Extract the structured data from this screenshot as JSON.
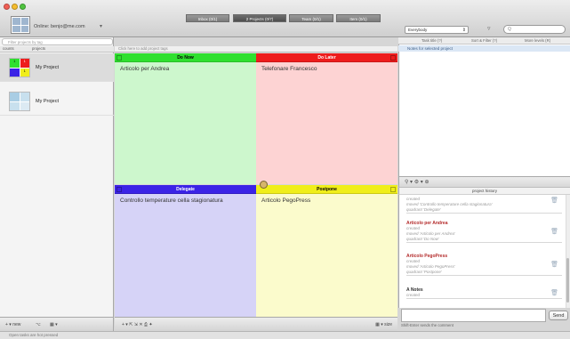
{
  "window": {
    "online_label": "Online: benjo@me.com",
    "tabs": [
      {
        "label": "Inbox (0/1)",
        "active": false
      },
      {
        "label": "2 Projects (0/7)",
        "active": true
      },
      {
        "label": "Team (0/1)",
        "active": false
      },
      {
        "label": "Item (0/1)",
        "active": false
      }
    ],
    "filter_select": "Everybody",
    "search_placeholder": "Q"
  },
  "sidebar": {
    "filter_placeholder": "Filter projects by tag",
    "col_counts": "counts",
    "col_projects": "projects",
    "projects": [
      {
        "name": "My Project",
        "selected": true,
        "counts": [
          "1",
          "1",
          "",
          "1"
        ]
      },
      {
        "name": "My Project",
        "selected": false,
        "counts": [
          "",
          "",
          "",
          ""
        ]
      }
    ],
    "bottom_left": "+ ▾ new",
    "bottom_mid": "⌥",
    "bottom_right": "▦ ▾"
  },
  "matrix": {
    "add_tags_hint": "Click here to add project tags",
    "quadrants": [
      {
        "label": "Do Now",
        "head_color": "#2fe02f",
        "body_color": "#cdf7cd",
        "text_color": "#000000",
        "tasks": [
          "Articolo per Andrea"
        ]
      },
      {
        "label": "Do Later",
        "head_color": "#ee1c1c",
        "body_color": "#fdd3d3",
        "text_color": "#ffffff",
        "tasks": [
          "Telefonare Francesco"
        ]
      },
      {
        "label": "Delegate",
        "head_color": "#3b23e6",
        "body_color": "#d6d3f7",
        "text_color": "#ffffff",
        "tasks": [
          "Controllo temperature cella stagionatura"
        ]
      },
      {
        "label": "Postpone",
        "head_color": "#f0ee1a",
        "body_color": "#fbfbcc",
        "text_color": "#000000",
        "tasks": [
          "Articolo PegoPress"
        ]
      }
    ],
    "bottom_left": "+ ▾ ⇱ ⇲ ✕ ⎙ ✦",
    "bottom_right": "▦ ▾ size"
  },
  "right_top": {
    "col_a": "Task title (?)",
    "col_b": "Sort & Filter (?)",
    "col_c": "More levels (R)",
    "row_label": "Notes for selected project"
  },
  "history": {
    "toolbar_icons": "⚲ ▾   ⚙ ▾   ⊕",
    "title": "project history",
    "items": [
      {
        "title": "",
        "lines": [
          "created",
          "moved 'Controllo temperature cella stagionatura'",
          "quadrant 'Delegate'"
        ]
      },
      {
        "title": "Articolo per Andrea",
        "lines": [
          "created",
          "moved 'Articolo per Andrea'",
          "quadrant 'Do Now'"
        ]
      },
      {
        "title": "Articolo PegoPress",
        "lines": [
          "created",
          "moved 'Articolo PegoPress'",
          "quadrant 'Postpone'"
        ]
      },
      {
        "title": "A Notes",
        "lines": [
          "created"
        ]
      }
    ],
    "send_label": "Send",
    "comment_hint": "Shift-Enter sends the comment"
  },
  "status": {
    "text": "Open tasks are hot pressed"
  }
}
